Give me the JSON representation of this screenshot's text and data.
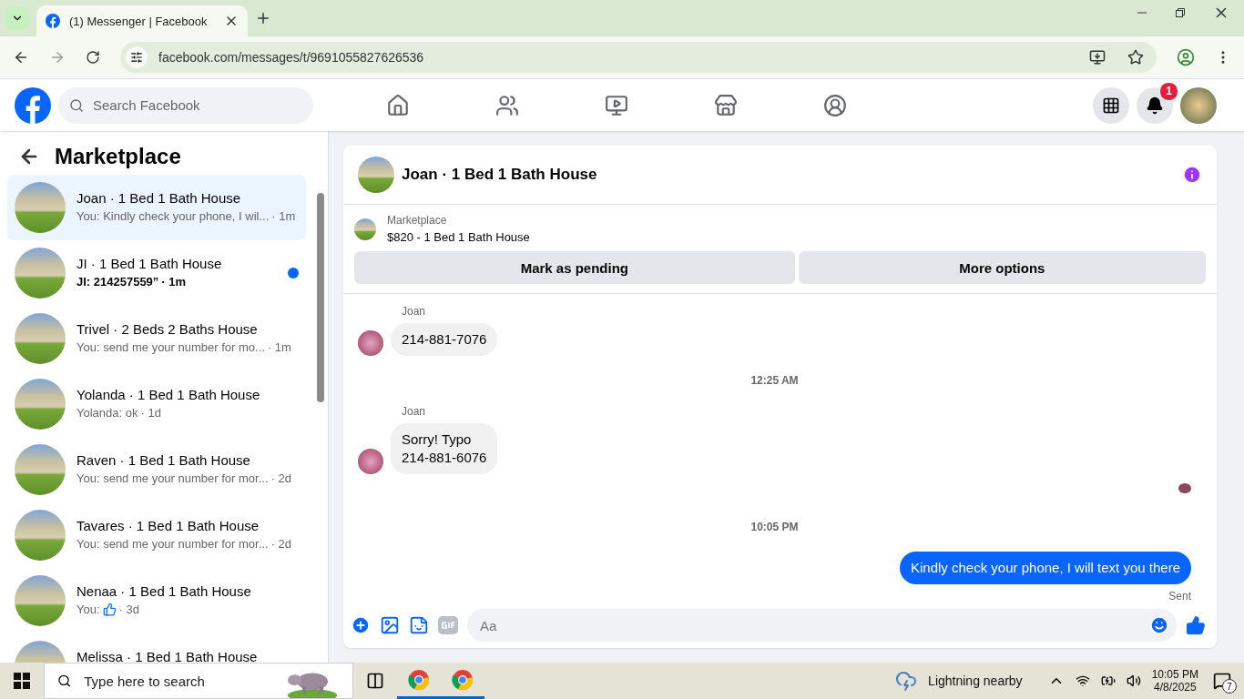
{
  "browser": {
    "tab_title": "(1) Messenger | Facebook",
    "url": "facebook.com/messages/t/9691055827626536"
  },
  "topbar": {
    "search_placeholder": "Search Facebook",
    "notification_count": "1"
  },
  "sidebar": {
    "title": "Marketplace",
    "conversations": [
      {
        "title": "Joan · 1 Bed 1 Bath House",
        "kind": "text",
        "preview": "You: Kindly check your phone, I wil...",
        "time": "· 1m",
        "selected": true,
        "unread": false
      },
      {
        "title": "JI · 1 Bed 1 Bath House",
        "kind": "text",
        "preview": "JI: 214257559”",
        "time": "· 1m",
        "selected": false,
        "unread": true
      },
      {
        "title": "Trivel · 2 Beds 2 Baths House",
        "kind": "text",
        "preview": "You: send me your number for mo...",
        "time": "· 1m",
        "selected": false,
        "unread": false
      },
      {
        "title": "Yolanda · 1 Bed 1 Bath House",
        "kind": "text",
        "preview": "Yolanda: ok",
        "time": "· 1d",
        "selected": false,
        "unread": false
      },
      {
        "title": "Raven · 1 Bed 1 Bath House",
        "kind": "text",
        "preview": "You: send me your number for mor...",
        "time": "· 2d",
        "selected": false,
        "unread": false
      },
      {
        "title": "Tavares · 1 Bed 1 Bath House",
        "kind": "text",
        "preview": "You: send me your number for mor...",
        "time": "· 2d",
        "selected": false,
        "unread": false
      },
      {
        "title": "Nenaa · 1 Bed 1 Bath House",
        "kind": "like",
        "preview": "You:",
        "time": "· 3d",
        "selected": false,
        "unread": false
      },
      {
        "title": "Melissa · 1 Bed 1 Bath House",
        "selected": false,
        "unread": false
      }
    ]
  },
  "chat": {
    "title": "Joan · 1 Bed 1 Bath House",
    "listing_label": "Marketplace",
    "listing_title": "$820 - 1 Bed 1 Bath House",
    "actions": [
      "Mark as pending",
      "More options"
    ],
    "thread": [
      {
        "kind": "incoming",
        "sender": "Joan",
        "lines": [
          "214-881-7076"
        ]
      },
      {
        "kind": "time",
        "text": "12:25 AM"
      },
      {
        "kind": "incoming",
        "sender": "Joan",
        "lines": [
          "Sorry! Typo",
          "214-881-6076"
        ]
      },
      {
        "kind": "seen"
      },
      {
        "kind": "time",
        "text": "10:05 PM"
      },
      {
        "kind": "outgoing",
        "lines": [
          "Kindly check your phone, I will text you there"
        ],
        "status": "Sent"
      }
    ],
    "composer_placeholder": "Aa"
  },
  "taskbar": {
    "search_placeholder": "Type here to search",
    "weather": "Lightning nearby",
    "time": "10:05 PM",
    "date": "4/8/2025",
    "notification_count": "7"
  }
}
